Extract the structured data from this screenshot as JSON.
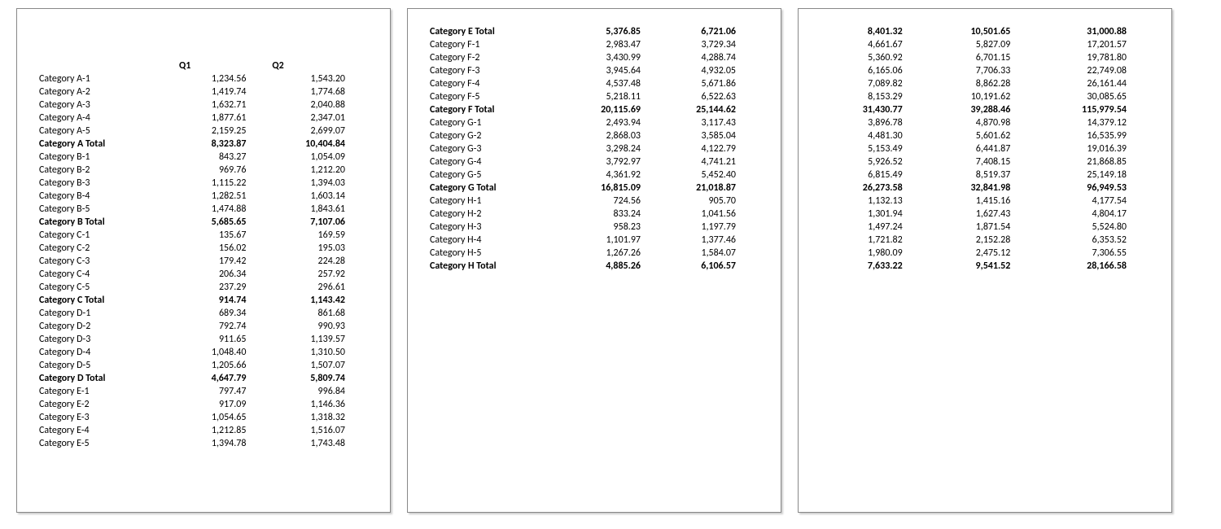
{
  "headers": {
    "q1": "Q1",
    "q2": "Q2"
  },
  "page1_rows": [
    {
      "label": "Category A-1",
      "q1": "1,234.56",
      "q2": "1,543.20",
      "total": false
    },
    {
      "label": "Category A-2",
      "q1": "1,419.74",
      "q2": "1,774.68",
      "total": false
    },
    {
      "label": "Category A-3",
      "q1": "1,632.71",
      "q2": "2,040.88",
      "total": false
    },
    {
      "label": "Category A-4",
      "q1": "1,877.61",
      "q2": "2,347.01",
      "total": false
    },
    {
      "label": "Category A-5",
      "q1": "2,159.25",
      "q2": "2,699.07",
      "total": false
    },
    {
      "label": "Category A Total",
      "q1": "8,323.87",
      "q2": "10,404.84",
      "total": true
    },
    {
      "label": "Category B-1",
      "q1": "843.27",
      "q2": "1,054.09",
      "total": false
    },
    {
      "label": "Category B-2",
      "q1": "969.76",
      "q2": "1,212.20",
      "total": false
    },
    {
      "label": "Category B-3",
      "q1": "1,115.22",
      "q2": "1,394.03",
      "total": false
    },
    {
      "label": "Category B-4",
      "q1": "1,282.51",
      "q2": "1,603.14",
      "total": false
    },
    {
      "label": "Category B-5",
      "q1": "1,474.88",
      "q2": "1,843.61",
      "total": false
    },
    {
      "label": "Category B Total",
      "q1": "5,685.65",
      "q2": "7,107.06",
      "total": true
    },
    {
      "label": "Category C-1",
      "q1": "135.67",
      "q2": "169.59",
      "total": false
    },
    {
      "label": "Category C-2",
      "q1": "156.02",
      "q2": "195.03",
      "total": false
    },
    {
      "label": "Category C-3",
      "q1": "179.42",
      "q2": "224.28",
      "total": false
    },
    {
      "label": "Category C-4",
      "q1": "206.34",
      "q2": "257.92",
      "total": false
    },
    {
      "label": "Category C-5",
      "q1": "237.29",
      "q2": "296.61",
      "total": false
    },
    {
      "label": "Category C Total",
      "q1": "914.74",
      "q2": "1,143.42",
      "total": true
    },
    {
      "label": "Category D-1",
      "q1": "689.34",
      "q2": "861.68",
      "total": false
    },
    {
      "label": "Category D-2",
      "q1": "792.74",
      "q2": "990.93",
      "total": false
    },
    {
      "label": "Category D-3",
      "q1": "911.65",
      "q2": "1,139.57",
      "total": false
    },
    {
      "label": "Category D-4",
      "q1": "1,048.40",
      "q2": "1,310.50",
      "total": false
    },
    {
      "label": "Category D-5",
      "q1": "1,205.66",
      "q2": "1,507.07",
      "total": false
    },
    {
      "label": "Category D Total",
      "q1": "4,647.79",
      "q2": "5,809.74",
      "total": true
    },
    {
      "label": "Category E-1",
      "q1": "797.47",
      "q2": "996.84",
      "total": false
    },
    {
      "label": "Category E-2",
      "q1": "917.09",
      "q2": "1,146.36",
      "total": false
    },
    {
      "label": "Category E-3",
      "q1": "1,054.65",
      "q2": "1,318.32",
      "total": false
    },
    {
      "label": "Category E-4",
      "q1": "1,212.85",
      "q2": "1,516.07",
      "total": false
    },
    {
      "label": "Category E-5",
      "q1": "1,394.78",
      "q2": "1,743.48",
      "total": false
    }
  ],
  "page2_rows": [
    {
      "label": "Category E Total",
      "q1": "5,376.85",
      "q2": "6,721.06",
      "total": true
    },
    {
      "label": "Category F-1",
      "q1": "2,983.47",
      "q2": "3,729.34",
      "total": false
    },
    {
      "label": "Category F-2",
      "q1": "3,430.99",
      "q2": "4,288.74",
      "total": false
    },
    {
      "label": "Category F-3",
      "q1": "3,945.64",
      "q2": "4,932.05",
      "total": false
    },
    {
      "label": "Category F-4",
      "q1": "4,537.48",
      "q2": "5,671.86",
      "total": false
    },
    {
      "label": "Category F-5",
      "q1": "5,218.11",
      "q2": "6,522.63",
      "total": false
    },
    {
      "label": "Category F Total",
      "q1": "20,115.69",
      "q2": "25,144.62",
      "total": true
    },
    {
      "label": "Category G-1",
      "q1": "2,493.94",
      "q2": "3,117.43",
      "total": false
    },
    {
      "label": "Category G-2",
      "q1": "2,868.03",
      "q2": "3,585.04",
      "total": false
    },
    {
      "label": "Category G-3",
      "q1": "3,298.24",
      "q2": "4,122.79",
      "total": false
    },
    {
      "label": "Category G-4",
      "q1": "3,792.97",
      "q2": "4,741.21",
      "total": false
    },
    {
      "label": "Category G-5",
      "q1": "4,361.92",
      "q2": "5,452.40",
      "total": false
    },
    {
      "label": "Category G Total",
      "q1": "16,815.09",
      "q2": "21,018.87",
      "total": true
    },
    {
      "label": "Category H-1",
      "q1": "724.56",
      "q2": "905.70",
      "total": false
    },
    {
      "label": "Category H-2",
      "q1": "833.24",
      "q2": "1,041.56",
      "total": false
    },
    {
      "label": "Category H-3",
      "q1": "958.23",
      "q2": "1,197.79",
      "total": false
    },
    {
      "label": "Category H-4",
      "q1": "1,101.97",
      "q2": "1,377.46",
      "total": false
    },
    {
      "label": "Category H-5",
      "q1": "1,267.26",
      "q2": "1,584.07",
      "total": false
    },
    {
      "label": "Category H Total",
      "q1": "4,885.26",
      "q2": "6,106.57",
      "total": true
    }
  ],
  "page3_rows": [
    {
      "c1": "8,401.32",
      "c2": "10,501.65",
      "c3": "31,000.88",
      "total": true
    },
    {
      "c1": "4,661.67",
      "c2": "5,827.09",
      "c3": "17,201.57",
      "total": false
    },
    {
      "c1": "5,360.92",
      "c2": "6,701.15",
      "c3": "19,781.80",
      "total": false
    },
    {
      "c1": "6,165.06",
      "c2": "7,706.33",
      "c3": "22,749.08",
      "total": false
    },
    {
      "c1": "7,089.82",
      "c2": "8,862.28",
      "c3": "26,161.44",
      "total": false
    },
    {
      "c1": "8,153.29",
      "c2": "10,191.62",
      "c3": "30,085.65",
      "total": false
    },
    {
      "c1": "31,430.77",
      "c2": "39,288.46",
      "c3": "115,979.54",
      "total": true
    },
    {
      "c1": "3,896.78",
      "c2": "4,870.98",
      "c3": "14,379.12",
      "total": false
    },
    {
      "c1": "4,481.30",
      "c2": "5,601.62",
      "c3": "16,535.99",
      "total": false
    },
    {
      "c1": "5,153.49",
      "c2": "6,441.87",
      "c3": "19,016.39",
      "total": false
    },
    {
      "c1": "5,926.52",
      "c2": "7,408.15",
      "c3": "21,868.85",
      "total": false
    },
    {
      "c1": "6,815.49",
      "c2": "8,519.37",
      "c3": "25,149.18",
      "total": false
    },
    {
      "c1": "26,273.58",
      "c2": "32,841.98",
      "c3": "96,949.53",
      "total": true
    },
    {
      "c1": "1,132.13",
      "c2": "1,415.16",
      "c3": "4,177.54",
      "total": false
    },
    {
      "c1": "1,301.94",
      "c2": "1,627.43",
      "c3": "4,804.17",
      "total": false
    },
    {
      "c1": "1,497.24",
      "c2": "1,871.54",
      "c3": "5,524.80",
      "total": false
    },
    {
      "c1": "1,721.82",
      "c2": "2,152.28",
      "c3": "6,353.52",
      "total": false
    },
    {
      "c1": "1,980.09",
      "c2": "2,475.12",
      "c3": "7,306.55",
      "total": false
    },
    {
      "c1": "7,633.22",
      "c2": "9,541.52",
      "c3": "28,166.58",
      "total": true
    }
  ]
}
